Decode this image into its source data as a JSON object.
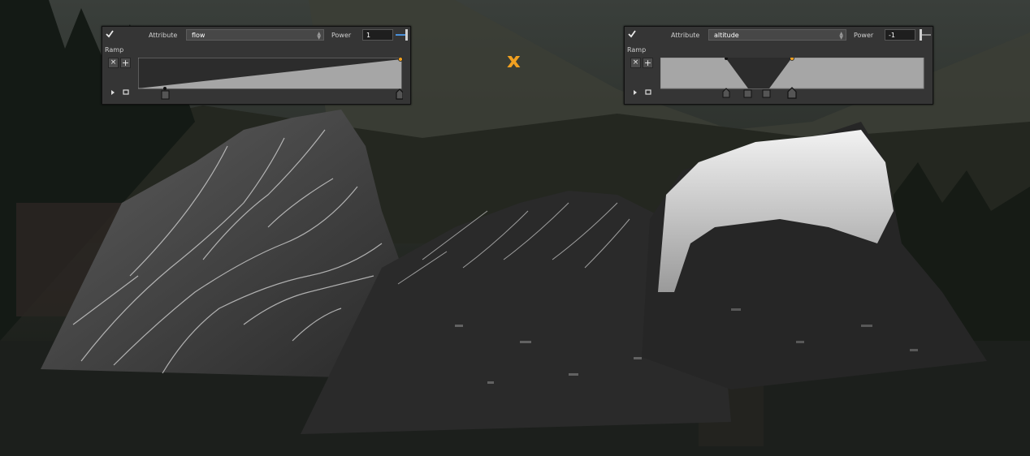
{
  "left_panel": {
    "attribute_label": "Attribute",
    "attribute_value": "flow",
    "power_label": "Power",
    "power_value": "1",
    "ramp_label": "Ramp",
    "remove_key_label": "×",
    "add_key_label": "+"
  },
  "right_panel": {
    "attribute_label": "Attribute",
    "attribute_value": "altitude",
    "power_label": "Power",
    "power_value": "-1",
    "ramp_label": "Ramp",
    "remove_key_label": "×",
    "add_key_label": "+"
  },
  "operator": "x",
  "colors": {
    "accent": "#f0a020",
    "panel_bg": "#353535",
    "ramp_fill": "#a6a6a6",
    "ramp_dark": "#2c2c2c"
  }
}
